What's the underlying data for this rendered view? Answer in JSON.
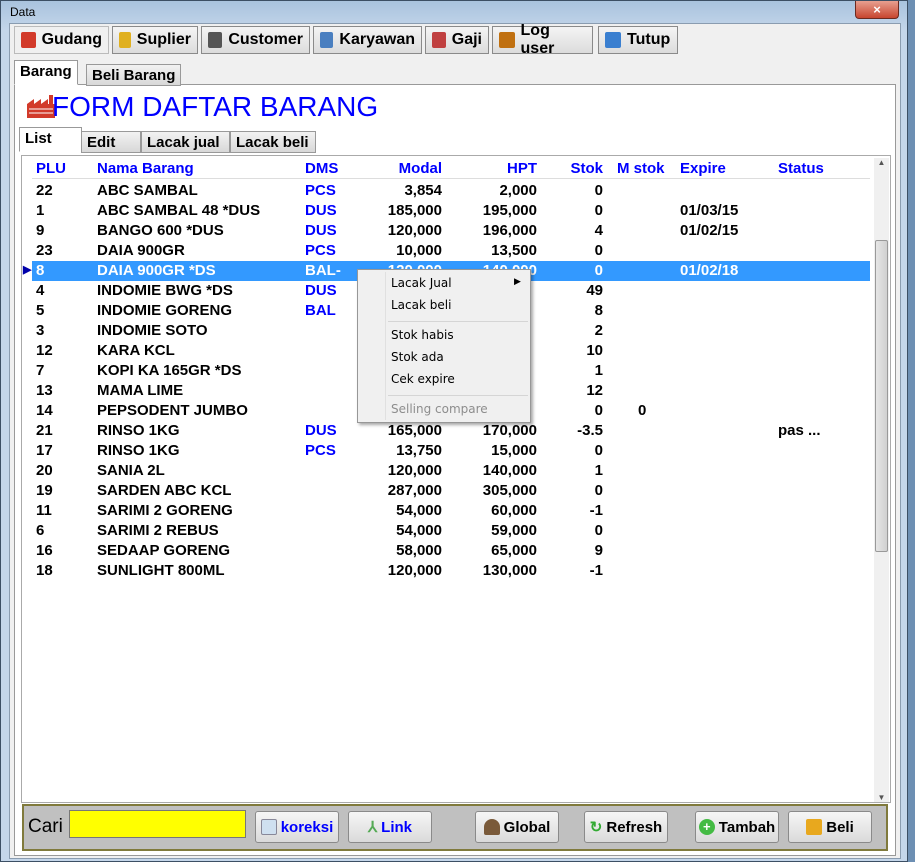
{
  "window": {
    "title": "Data",
    "close_icon": "×"
  },
  "main_tabs": [
    {
      "label": "Gudang",
      "icon": "factory-icon"
    },
    {
      "label": "Suplier",
      "icon": "forklift-icon"
    },
    {
      "label": "Customer",
      "icon": "person-icon"
    },
    {
      "label": "Karyawan",
      "icon": "users-icon"
    },
    {
      "label": "Gaji",
      "icon": "calendar-icon"
    },
    {
      "label": "Log user",
      "icon": "bug-icon"
    },
    {
      "label": "Tutup",
      "icon": "exit-icon"
    }
  ],
  "sub_tabs": [
    "Barang",
    "Beli Barang"
  ],
  "form_title": "FORM DAFTAR BARANG",
  "list_tabs": [
    "List",
    "Edit",
    "Lacak jual",
    "Lacak beli"
  ],
  "columns": [
    "PLU",
    "Nama Barang",
    "DMS",
    "Modal",
    "HPT",
    "Stok",
    "M stok",
    "Expire",
    "Status"
  ],
  "rows": [
    [
      "22",
      "ABC SAMBAL",
      "PCS",
      "3,854",
      "2,000",
      "0",
      "",
      "",
      ""
    ],
    [
      "1",
      "ABC SAMBAL 48 *DUS",
      "DUS",
      "185,000",
      "195,000",
      "0",
      "",
      "01/03/15",
      ""
    ],
    [
      "9",
      "BANGO 600 *DUS",
      "DUS",
      "120,000",
      "196,000",
      "4",
      "",
      "01/02/15",
      ""
    ],
    [
      "23",
      "DAIA 900GR",
      "PCS",
      "10,000",
      "13,500",
      "0",
      "",
      "",
      ""
    ],
    [
      "8",
      "DAIA 900GR *DS",
      "BAL-",
      "120,000",
      "140,000",
      "0",
      "",
      "01/02/18",
      ""
    ],
    [
      "4",
      "INDOMIE BWG *DS",
      "DUS",
      "",
      "",
      "49",
      "",
      "",
      ""
    ],
    [
      "5",
      "INDOMIE GORENG",
      "BAL",
      "",
      "",
      "8",
      "",
      "",
      ""
    ],
    [
      "3",
      "INDOMIE SOTO",
      "",
      "",
      "",
      "2",
      "",
      "",
      ""
    ],
    [
      "12",
      "KARA KCL",
      "",
      "",
      "",
      "10",
      "",
      "",
      ""
    ],
    [
      "7",
      "KOPI KA 165GR *DS",
      "",
      "",
      "",
      "1",
      "",
      "",
      ""
    ],
    [
      "13",
      "MAMA LIME",
      "",
      "",
      "",
      "12",
      "",
      "",
      ""
    ],
    [
      "14",
      "PEPSODENT JUMBO",
      "",
      "",
      "",
      "0",
      "0",
      "",
      ""
    ],
    [
      "21",
      "RINSO 1KG",
      "DUS",
      "165,000",
      "170,000",
      "-3.5",
      "",
      "",
      "pas ..."
    ],
    [
      "17",
      "RINSO 1KG",
      "PCS",
      "13,750",
      "15,000",
      "0",
      "",
      "",
      ""
    ],
    [
      "20",
      "SANIA 2L",
      "",
      "120,000",
      "140,000",
      "1",
      "",
      "",
      ""
    ],
    [
      "19",
      "SARDEN ABC KCL",
      "",
      "287,000",
      "305,000",
      "0",
      "",
      "",
      ""
    ],
    [
      "11",
      "SARIMI 2 GORENG",
      "",
      "54,000",
      "60,000",
      "-1",
      "",
      "",
      ""
    ],
    [
      "6",
      "SARIMI 2 REBUS",
      "",
      "54,000",
      "59,000",
      "0",
      "",
      "",
      ""
    ],
    [
      "16",
      "SEDAAP GORENG",
      "",
      "58,000",
      "65,000",
      "9",
      "",
      "",
      ""
    ],
    [
      "18",
      "SUNLIGHT 800ML",
      "",
      "120,000",
      "130,000",
      "-1",
      "",
      "",
      ""
    ]
  ],
  "selected_row": 4,
  "context_menu": [
    "Lacak Jual",
    "Lacak beli",
    "Stok habis",
    "Stok ada",
    "Cek expire",
    "Selling compare"
  ],
  "bottom": {
    "search_label": "Cari",
    "search_value": "",
    "buttons": [
      "koreksi",
      "Link",
      "Global",
      "Refresh",
      "Tambah",
      "Beli"
    ]
  },
  "colors": {
    "accent": "#0000ff",
    "selection": "#3399ff",
    "search_bg": "#ffff00"
  }
}
